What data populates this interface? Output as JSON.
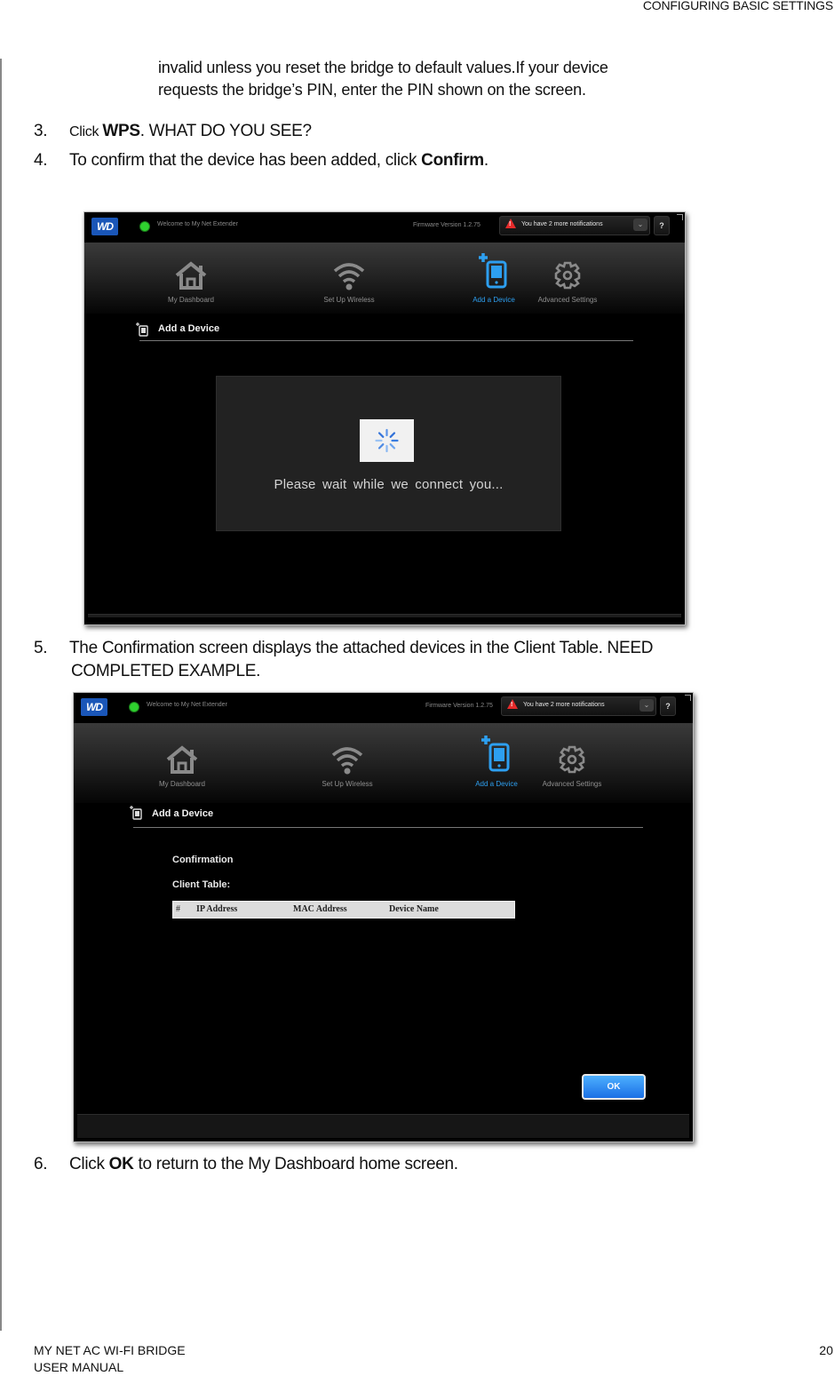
{
  "header": {
    "section_title": "CONFIGURING BASIC SETTINGS"
  },
  "body": {
    "intro_line1": "invalid unless you reset the bridge to default values.If your device",
    "intro_line2": "requests the bridge’s PIN, enter the PIN shown on the screen.",
    "steps": [
      {
        "num": "3.",
        "pre_small": "Click ",
        "bold": "WPS",
        "post": ". WHAT DO YOU SEE?"
      },
      {
        "num": "4.",
        "pre": "To confirm that the device has been added, click ",
        "bold": "Confirm",
        "post": "."
      },
      {
        "num": "5.",
        "line1": "The Confirmation screen displays the attached devices in the Client Table. NEED",
        "line2": "COMPLETED EXAMPLE."
      },
      {
        "num": "6.",
        "pre": "Click ",
        "bold": "OK",
        "post": " to return to the My Dashboard home screen."
      }
    ]
  },
  "app": {
    "logo": "WD",
    "welcome": "Welcome to My Net Extender",
    "firmware": "Firmware Version 1.2.75",
    "notification": "You have 2 more notifications",
    "help_label": "?",
    "nav": [
      {
        "label": "My Dashboard",
        "icon": "home-icon",
        "active": false
      },
      {
        "label": "Set Up Wireless",
        "icon": "wifi-icon",
        "active": false
      },
      {
        "label": "Add a Device",
        "icon": "add-device-icon",
        "active": true
      },
      {
        "label": "Advanced Settings",
        "icon": "gear-icon",
        "active": false
      }
    ],
    "section_title": "Add a Device",
    "accent_color": "#2d9ff0"
  },
  "screenshot1": {
    "wait_message": "Please wait while we connect you..."
  },
  "screenshot2": {
    "confirmation_heading": "Confirmation",
    "client_table_label": "Client Table:",
    "client_table_columns": [
      "#",
      "IP Address",
      "MAC Address",
      "Device Name"
    ],
    "client_table_rows": [],
    "ok_label": "OK"
  },
  "footer": {
    "product": "MY NET AC WI-FI BRIDGE",
    "doc": "USER MANUAL",
    "page": "20"
  }
}
